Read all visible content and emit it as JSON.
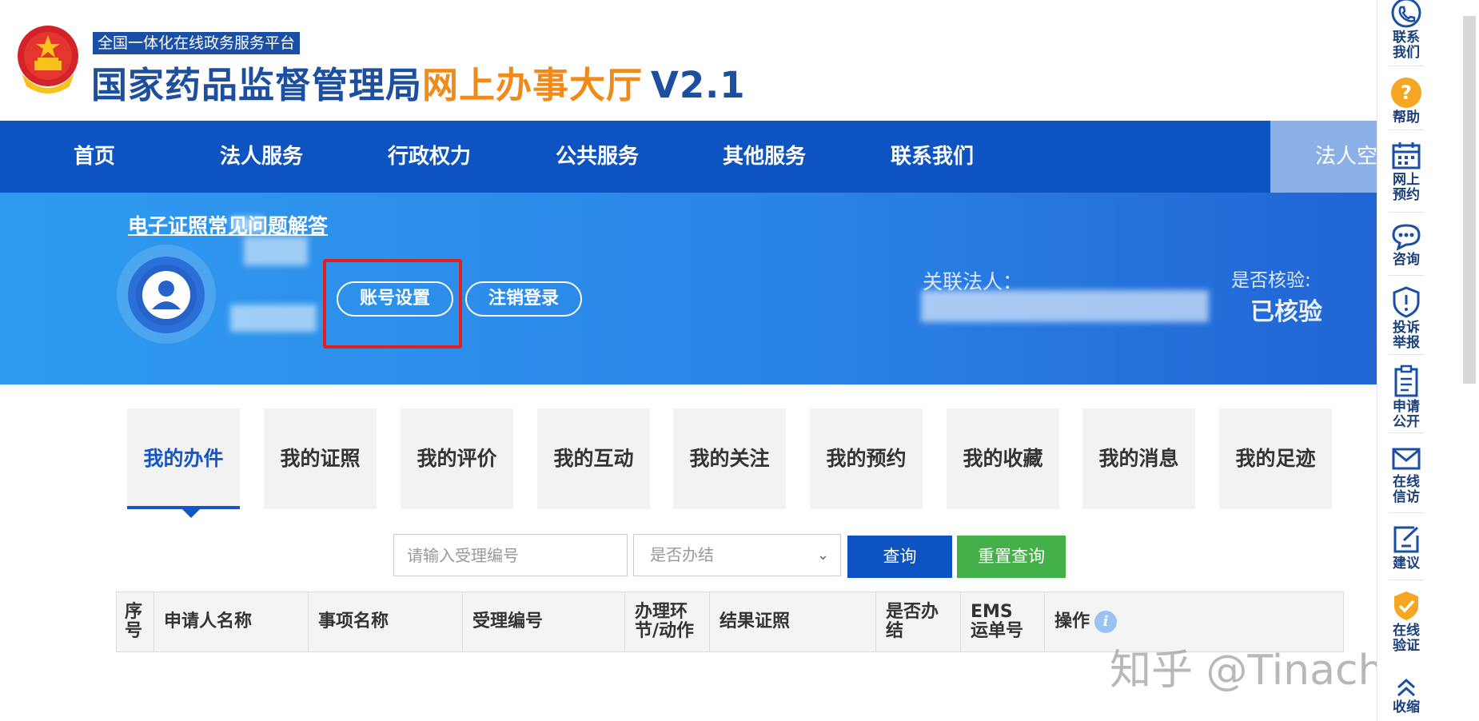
{
  "header": {
    "platform_tag": "全国一体化在线政务服务平台",
    "title_main": "国家药品监督管理局",
    "title_accent": "网上办事大厅",
    "title_version": "V2.1"
  },
  "nav": {
    "items": [
      "首页",
      "法人服务",
      "行政权力",
      "公共服务",
      "其他服务",
      "联系我们"
    ],
    "space_label": "法人空间"
  },
  "banner": {
    "faq_link": "电子证照常见问题解答",
    "account_settings": "账号设置",
    "logout": "注销登录",
    "assoc_label": "关联法人：",
    "verify_label": "是否核验:",
    "verify_value": "已核验"
  },
  "tabs": [
    "我的办件",
    "我的证照",
    "我的评价",
    "我的互动",
    "我的关注",
    "我的预约",
    "我的收藏",
    "我的消息",
    "我的足迹"
  ],
  "active_tab": "我的办件",
  "search": {
    "placeholder": "请输入受理编号",
    "status_placeholder": "是否办结",
    "query_button": "查询",
    "reset_button": "重置查询"
  },
  "table": {
    "columns": [
      "序号",
      "申请人名称",
      "事项名称",
      "受理编号",
      "办理环节/动作",
      "结果证照",
      "是否办结",
      "EMS运单号",
      "操作"
    ]
  },
  "rail": {
    "items": [
      {
        "label": "联系我们",
        "icon": "phone-icon"
      },
      {
        "label": "帮助",
        "icon": "help-icon"
      },
      {
        "label": "网上预约",
        "icon": "calendar-icon"
      },
      {
        "label": "咨询",
        "icon": "chat-icon"
      },
      {
        "label": "投诉举报",
        "icon": "shield-alert-icon"
      },
      {
        "label": "申请公开",
        "icon": "clipboard-icon"
      },
      {
        "label": "在线信访",
        "icon": "mail-icon"
      },
      {
        "label": "建议",
        "icon": "edit-icon"
      },
      {
        "label": "在线验证",
        "icon": "shield-check-icon"
      },
      {
        "label": "收缩",
        "icon": "collapse-icon"
      }
    ]
  },
  "watermark": "知乎 @Tinachen",
  "colors": {
    "nav_bg": "#0d53c1",
    "brand_blue": "#1d4fa1",
    "accent_orange": "#f08a1a",
    "query_button": "#0d53c1",
    "reset_button": "#43b04a",
    "highlight_border": "#e0211f"
  }
}
